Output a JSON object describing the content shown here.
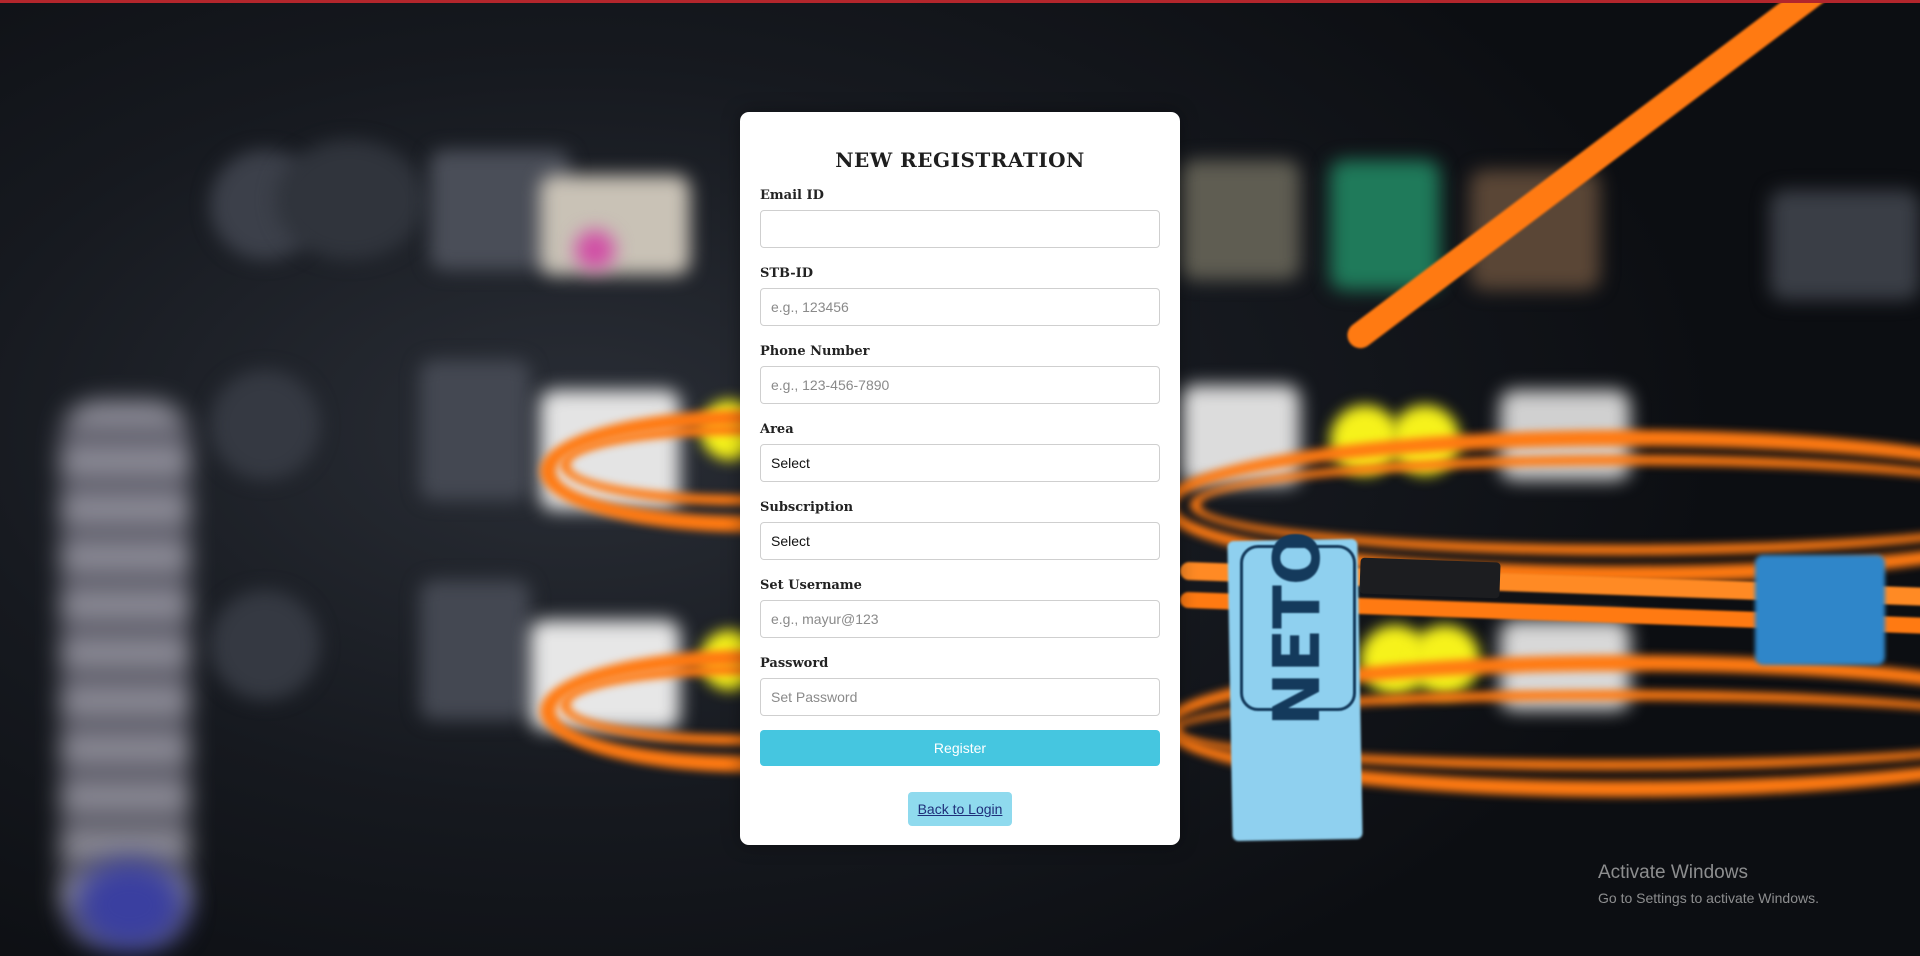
{
  "form": {
    "title": "NEW REGISTRATION",
    "fields": {
      "email": {
        "label": "Email ID",
        "placeholder": "",
        "value": ""
      },
      "stb": {
        "label": "STB-ID",
        "placeholder": "e.g., 123456",
        "value": ""
      },
      "phone": {
        "label": "Phone Number",
        "placeholder": "e.g., 123-456-7890",
        "value": ""
      },
      "area": {
        "label": "Area",
        "selected": "Select"
      },
      "subscription": {
        "label": "Subscription",
        "selected": "Select"
      },
      "username": {
        "label": "Set Username",
        "placeholder": "e.g., mayur@123",
        "value": ""
      },
      "password": {
        "label": "Password",
        "placeholder": "Set Password",
        "value": ""
      }
    },
    "register_label": "Register",
    "back_label": "Back to Login"
  },
  "background": {
    "tag_text": "NETO"
  },
  "watermark": {
    "line1": "Activate Windows",
    "line2": "Go to Settings to activate Windows."
  },
  "colors": {
    "accent": "#45c6e0",
    "back_button": "#8fdaee",
    "top_bar": "#b3262c",
    "cable": "#ff7a12"
  }
}
